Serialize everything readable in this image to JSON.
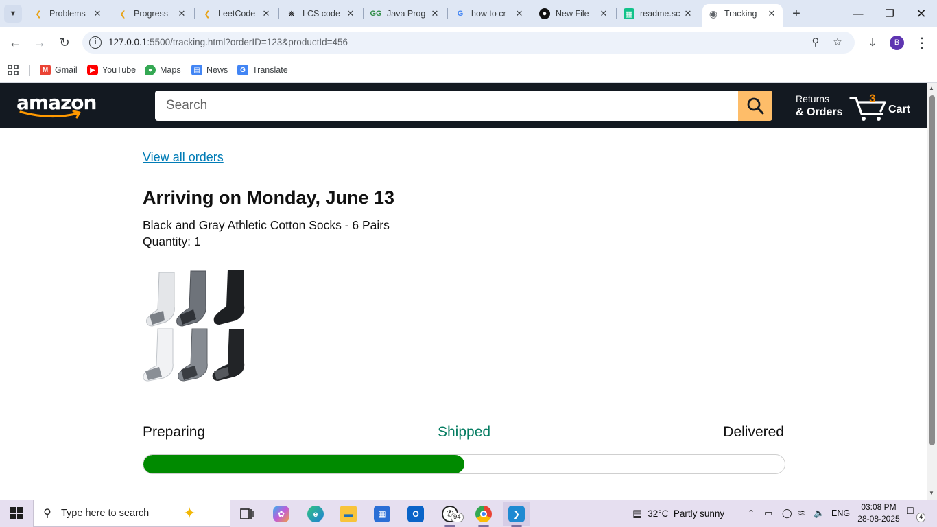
{
  "browser": {
    "tabs": [
      {
        "title": "Problems",
        "favicon": "leetcode-icon",
        "favicon_color": "#e8a317"
      },
      {
        "title": "Progress",
        "favicon": "leetcode-icon",
        "favicon_color": "#e8a317"
      },
      {
        "title": "LeetCode",
        "favicon": "leetcode-icon",
        "favicon_color": "#e8a317"
      },
      {
        "title": "LCS code",
        "favicon": "chatgpt-icon",
        "favicon_color": "#111111"
      },
      {
        "title": "Java Prog",
        "favicon": "geeksforgeeks-icon",
        "favicon_color": "#2f8d46"
      },
      {
        "title": "how to cr",
        "favicon": "google-icon",
        "favicon_color": "#4285f4"
      },
      {
        "title": "New File",
        "favicon": "github-icon",
        "favicon_color": "#111111"
      },
      {
        "title": "readme.sc",
        "favicon": "readme-icon",
        "favicon_color": "#12c28a"
      },
      {
        "title": "Tracking",
        "favicon": "globe-icon",
        "favicon_color": "#5f6368",
        "active": true
      }
    ],
    "url_host": "127.0.0.1",
    "url_rest": ":5500/tracking.html?orderID=123&productId=456",
    "profile_initial": "B",
    "bookmarks": [
      {
        "label": "Gmail",
        "icon": "gmail-icon",
        "color": "#ea4335"
      },
      {
        "label": "YouTube",
        "icon": "youtube-icon",
        "color": "#ff0000"
      },
      {
        "label": "Maps",
        "icon": "maps-icon",
        "color": "#34a853"
      },
      {
        "label": "News",
        "icon": "news-icon",
        "color": "#4285f4"
      },
      {
        "label": "Translate",
        "icon": "translate-icon",
        "color": "#4285f4"
      }
    ]
  },
  "amazon": {
    "logo_text": "amazon",
    "search_placeholder": "Search",
    "returns_line1": "Returns",
    "returns_line2": "& Orders",
    "cart_count": "3",
    "cart_label": "Cart",
    "colors": {
      "header_bg": "#131921",
      "search_button": "#febd69",
      "cart_count": "#f08804",
      "link": "#017cb6",
      "progress_fill": "#008a00",
      "current_status": "#067d62"
    }
  },
  "order": {
    "view_all_orders": "View all orders",
    "arriving": "Arriving on Monday, June 13",
    "product_name": "Black and Gray Athletic Cotton Socks - 6 Pairs",
    "quantity": "Quantity: 1",
    "statuses": [
      "Preparing",
      "Shipped",
      "Delivered"
    ],
    "current_status": "Shipped",
    "progress_fraction": 0.5
  },
  "taskbar": {
    "search_placeholder": "Type here to search",
    "whatsapp_badge": "94",
    "weather": "32°C  Partly sunny",
    "language": "ENG",
    "time": "03:08 PM",
    "date": "28-08-2025",
    "notifications": "4"
  }
}
